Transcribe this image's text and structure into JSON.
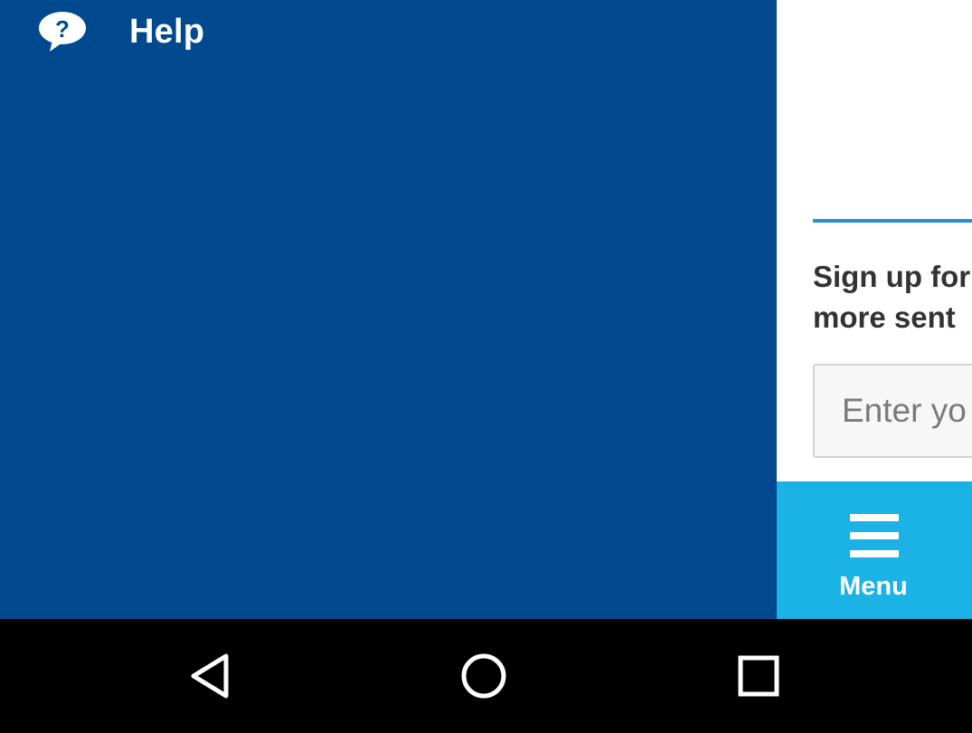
{
  "drawer": {
    "background": "#00498f",
    "help": {
      "label": "Help",
      "icon": "help-bubble-icon"
    }
  },
  "content": {
    "divider_color": "#2a8fd3",
    "signup": {
      "line1": "Sign up for",
      "line2": "more sent"
    },
    "email_input": {
      "placeholder": "Enter yo",
      "value": ""
    }
  },
  "tabbar": {
    "background": "#1bb2e6",
    "menu": {
      "label": "Menu",
      "icon": "hamburger-icon"
    }
  },
  "system_nav": {
    "back": "back-icon",
    "home": "home-icon",
    "recents": "recents-icon"
  }
}
